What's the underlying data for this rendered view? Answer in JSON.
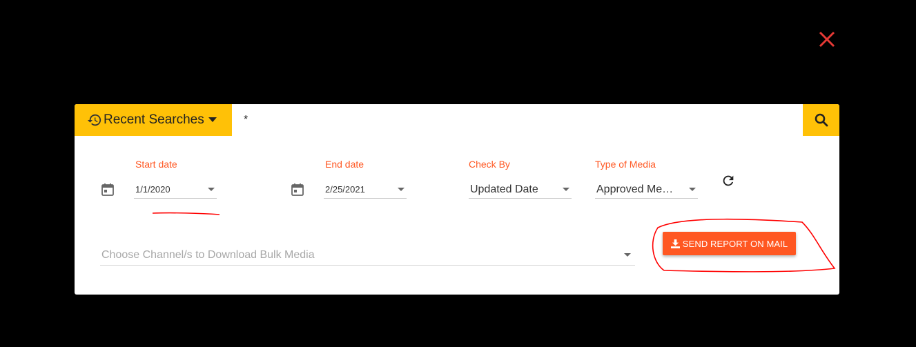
{
  "close_icon": "close-icon",
  "search": {
    "recent_label": "Recent Searches",
    "query": "*"
  },
  "filters": {
    "start_date": {
      "label": "Start date",
      "value": "1/1/2020"
    },
    "end_date": {
      "label": "End date",
      "value": "2/25/2021"
    },
    "check_by": {
      "label": "Check By",
      "value": "Updated Date"
    },
    "media_type": {
      "label": "Type of Media",
      "value": "Approved Me…"
    }
  },
  "channel": {
    "placeholder": "Choose Channel/s to Download Bulk Media"
  },
  "send_button_label": "SEND REPORT ON MAIL",
  "colors": {
    "accent": "#ffc107",
    "action": "#ff5722",
    "close": "#e53935",
    "annotation": "#ff0000"
  }
}
